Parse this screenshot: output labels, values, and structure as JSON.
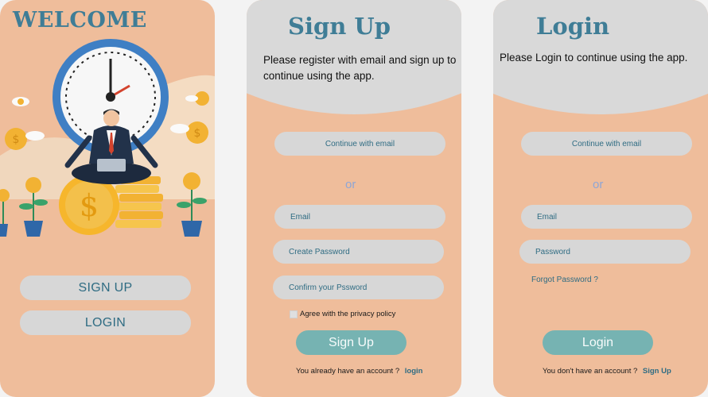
{
  "welcome": {
    "title": "WELCOME",
    "signup_label": "SIGN UP",
    "login_label": "LOGIN"
  },
  "signup": {
    "title": "Sign Up",
    "intro": "Please register with email and sign up to continue using the app.",
    "continue_email": "Continue with email",
    "or": "or",
    "email_placeholder": "Email",
    "password_placeholder": "Create Password",
    "confirm_placeholder": "Confirm your Pssword",
    "agree_text": "Agree with the privacy policy",
    "submit_label": "Sign Up",
    "footer_text": "You already have an account ?",
    "footer_link": "login"
  },
  "login": {
    "title": "Login",
    "intro": "Please Login to continue using the app.",
    "continue_email": "Continue with email",
    "or": "or",
    "email_placeholder": "Email",
    "password_placeholder": "Password",
    "forgot_label": "Forgot Password ?",
    "submit_label": "Login",
    "footer_text": "You don't have an account ?",
    "footer_link": "Sign Up"
  },
  "colors": {
    "card_bg": "#efbd9b",
    "accent_text": "#3f7d96",
    "pill_bg": "#d7d7d7",
    "action_bg": "#76b3b2",
    "page_bg": "#f3f3f3"
  }
}
